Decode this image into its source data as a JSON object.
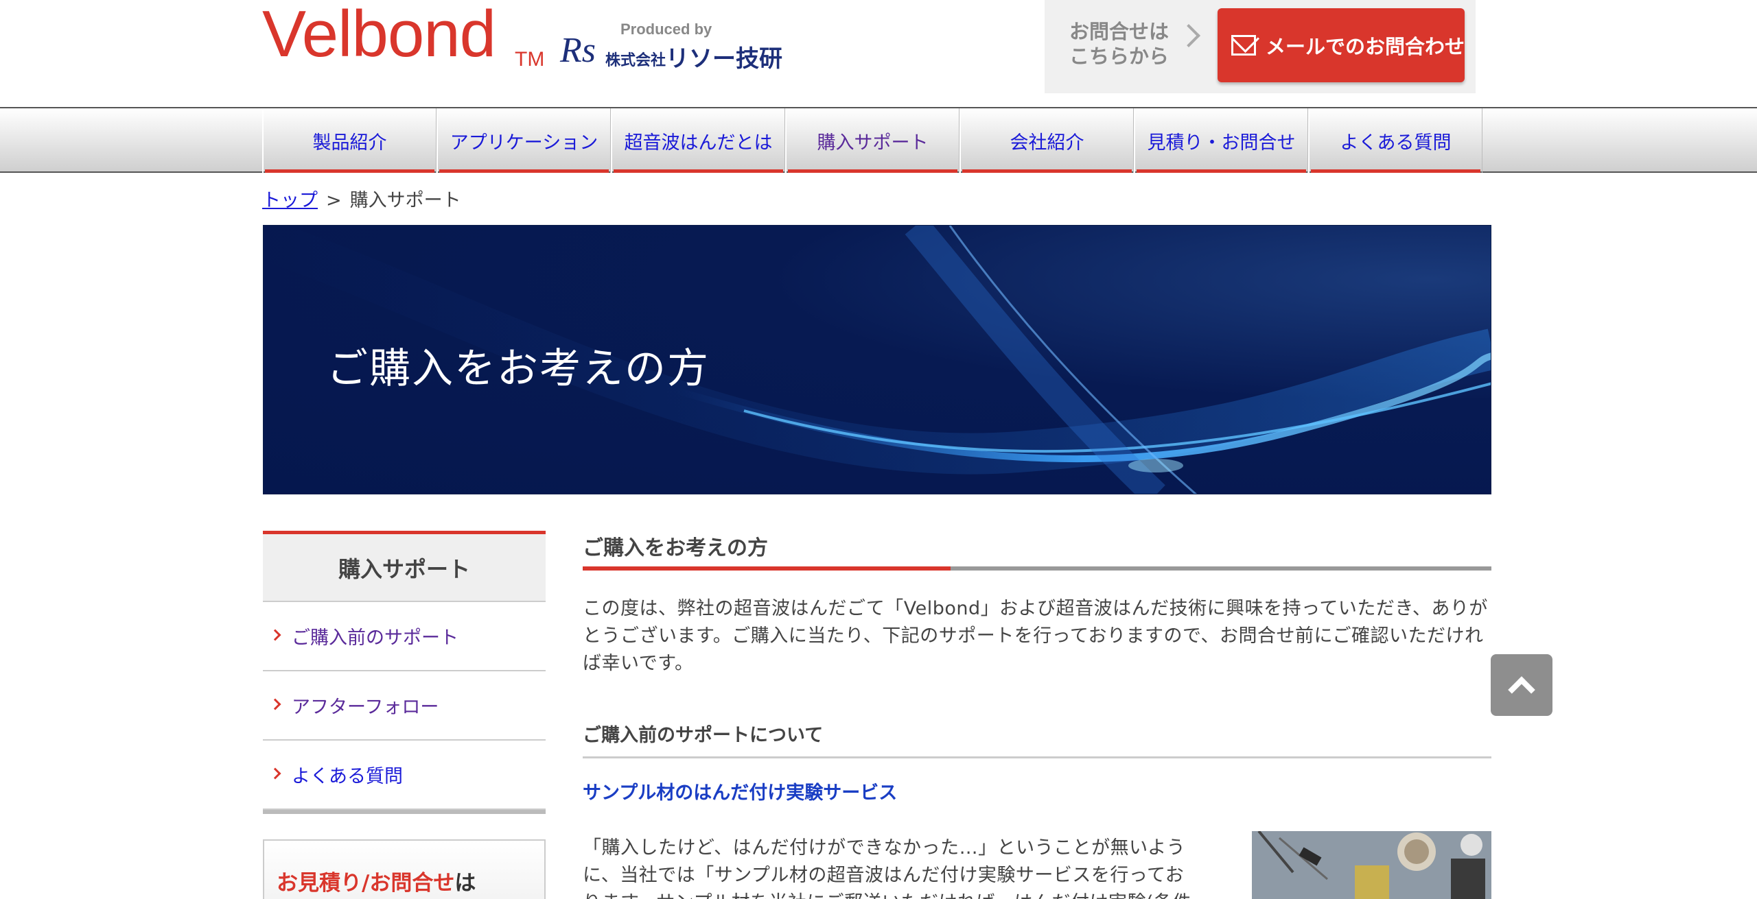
{
  "header": {
    "logo_text": "Velbond",
    "logo_tm": "TM",
    "produced_by": "Produced by",
    "rs_mark": "Rs",
    "company_small": "株式会社",
    "company_name": "リソー技研",
    "contact_label_line1": "お問合せは",
    "contact_label_line2": "こちらから",
    "mail_button_label": "メールでのお問合わせ"
  },
  "nav": {
    "items": [
      {
        "label": "製品紹介"
      },
      {
        "label": "アプリケーション"
      },
      {
        "label": "超音波はんだとは"
      },
      {
        "label": "購入サポート"
      },
      {
        "label": "会社紹介"
      },
      {
        "label": "見積り・お問合せ"
      },
      {
        "label": "よくある質問"
      }
    ]
  },
  "breadcrumb": {
    "home": "トップ",
    "separator": ">",
    "current": "購入サポート"
  },
  "hero": {
    "title": "ご購入をお考えの方"
  },
  "sidebar": {
    "heading": "購入サポート",
    "items": [
      {
        "label": "ご購入前のサポート"
      },
      {
        "label": "アフターフォロー"
      },
      {
        "label": "よくある質問"
      }
    ],
    "banner_red": "お見積り/お問合せ",
    "banner_dark": "は"
  },
  "main": {
    "title": "ご購入をお考えの方",
    "intro": "この度は、弊社の超音波はんだごて「Velbond」および超音波はんだ技術に興味を持っていただき、ありがとうございます。ご購入に当たり、下記のサポートを行っておりますので、お問合せ前にご確認いただければ幸いです。",
    "subheading": "ご購入前のサポートについて",
    "service_heading": "サンプル材のはんだ付け実験サービス",
    "service_text": "「購入したけど、はんだ付けができなかった…」ということが無いように、当社では「サンプル材の超音波はんだ付け実験サービスを行っております。サンプル材を当社にご郵送いただければ、はんだ付け実験(条件"
  },
  "colors": {
    "brand_red": "#d9362c",
    "link_blue": "#1a1ad8",
    "visited_purple": "#5a2a9a",
    "company_navy": "#1d2f7a"
  },
  "icons": {
    "mail": "mail-icon",
    "chevron": "chevron-right-icon",
    "back_to_top": "chevron-up-icon"
  }
}
